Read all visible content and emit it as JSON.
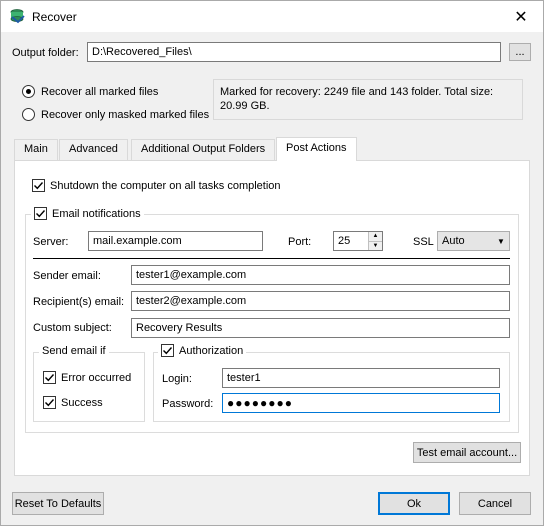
{
  "window": {
    "title": "Recover",
    "close_glyph": "✕"
  },
  "output": {
    "label": "Output folder:",
    "value": "D:\\Recovered_Files\\",
    "browse_label": "..."
  },
  "recover_mode": {
    "all_label": "Recover all marked files",
    "masked_label": "Recover only masked marked files",
    "selected": "all"
  },
  "info": {
    "text": "Marked for recovery: 2249 file and 143 folder. Total size: 20.99 GB."
  },
  "tabs": [
    {
      "label": "Main",
      "active": false
    },
    {
      "label": "Advanced",
      "active": false
    },
    {
      "label": "Additional Output Folders",
      "active": false
    },
    {
      "label": "Post Actions",
      "active": true
    }
  ],
  "post_actions": {
    "shutdown_label": "Shutdown the computer on all tasks completion",
    "shutdown_checked": true,
    "email_label": "Email notifications",
    "email_checked": true,
    "server_label": "Server:",
    "server_value": "mail.example.com",
    "port_label": "Port:",
    "port_value": "25",
    "ssl_label": "SSL",
    "ssl_value": "Auto",
    "sender_label": "Sender email:",
    "sender_value": "tester1@example.com",
    "recipient_label": "Recipient(s) email:",
    "recipient_value": "tester2@example.com",
    "subject_label": "Custom subject:",
    "subject_value": "Recovery Results",
    "send_if_label": "Send email if",
    "error_label": "Error occurred",
    "error_checked": true,
    "success_label": "Success",
    "success_checked": true,
    "auth_label": "Authorization",
    "auth_checked": true,
    "login_label": "Login:",
    "login_value": "tester1",
    "password_label": "Password:",
    "password_value": "●●●●●●●●",
    "test_button": "Test email account..."
  },
  "footer": {
    "reset_label": "Reset To Defaults",
    "ok_label": "Ok",
    "cancel_label": "Cancel"
  },
  "colors": {
    "accent": "#0078d7",
    "dialog_bg": "#f0f0f0"
  }
}
